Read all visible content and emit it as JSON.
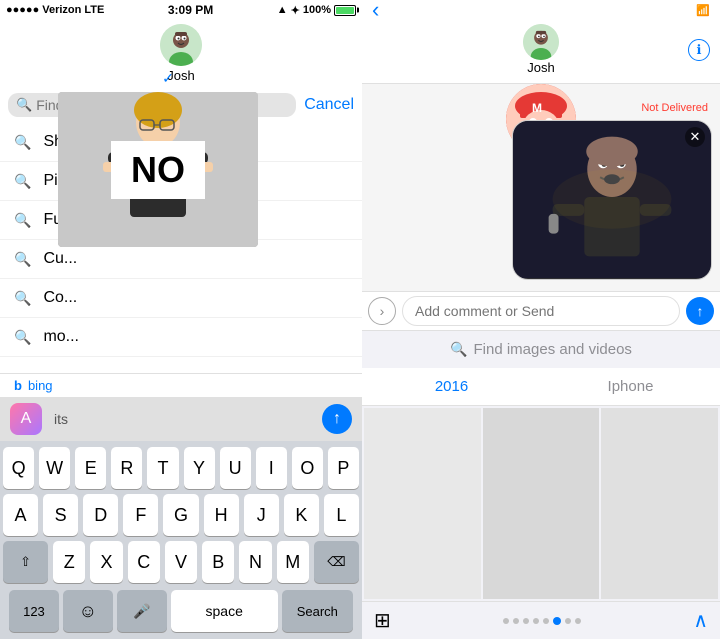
{
  "left": {
    "statusBar": {
      "carrier": "Verizon",
      "network": "LTE",
      "time": "3:09 PM",
      "battery": "100%"
    },
    "contact": {
      "name": "Josh"
    },
    "search": {
      "placeholder": "Find items...",
      "cancel_label": "Cancel"
    },
    "suggestions": [
      {
        "text": "Shi..."
      },
      {
        "text": "Pis..."
      },
      {
        "text": "Fu..."
      },
      {
        "text": "Cu..."
      },
      {
        "text": "Co..."
      },
      {
        "text": "mo..."
      }
    ],
    "bing_label": "bing",
    "appstore_label": "its",
    "keyboard": {
      "row1": [
        "Q",
        "W",
        "E",
        "R",
        "T",
        "Y",
        "U",
        "I",
        "O",
        "P"
      ],
      "row2": [
        "A",
        "S",
        "D",
        "F",
        "G",
        "H",
        "J",
        "K",
        "L"
      ],
      "row3": [
        "Z",
        "X",
        "C",
        "V",
        "B",
        "N",
        "M"
      ],
      "special_left": "⇧",
      "special_right": "⌫",
      "bottom_left": "123",
      "bottom_emoji": "☺",
      "bottom_mic": "🎤",
      "bottom_space": "space",
      "bottom_search": "Search"
    }
  },
  "right": {
    "statusBar": {
      "back_label": "‹"
    },
    "contact": {
      "name": "Josh",
      "info_icon": "ℹ"
    },
    "chat": {
      "not_delivered": "Not Delivered",
      "close_icon": "✕"
    },
    "reply": {
      "expand_icon": "›",
      "placeholder": "Add comment or Send",
      "send_icon": "↑"
    },
    "find_images": {
      "icon": "🔍",
      "label": "Find images and videos"
    },
    "tabs": [
      {
        "label": "2016",
        "active": true
      },
      {
        "label": "Iphone",
        "active": false
      }
    ],
    "bottom": {
      "grid_icon": "⊞",
      "chevron_up": "∧"
    }
  }
}
